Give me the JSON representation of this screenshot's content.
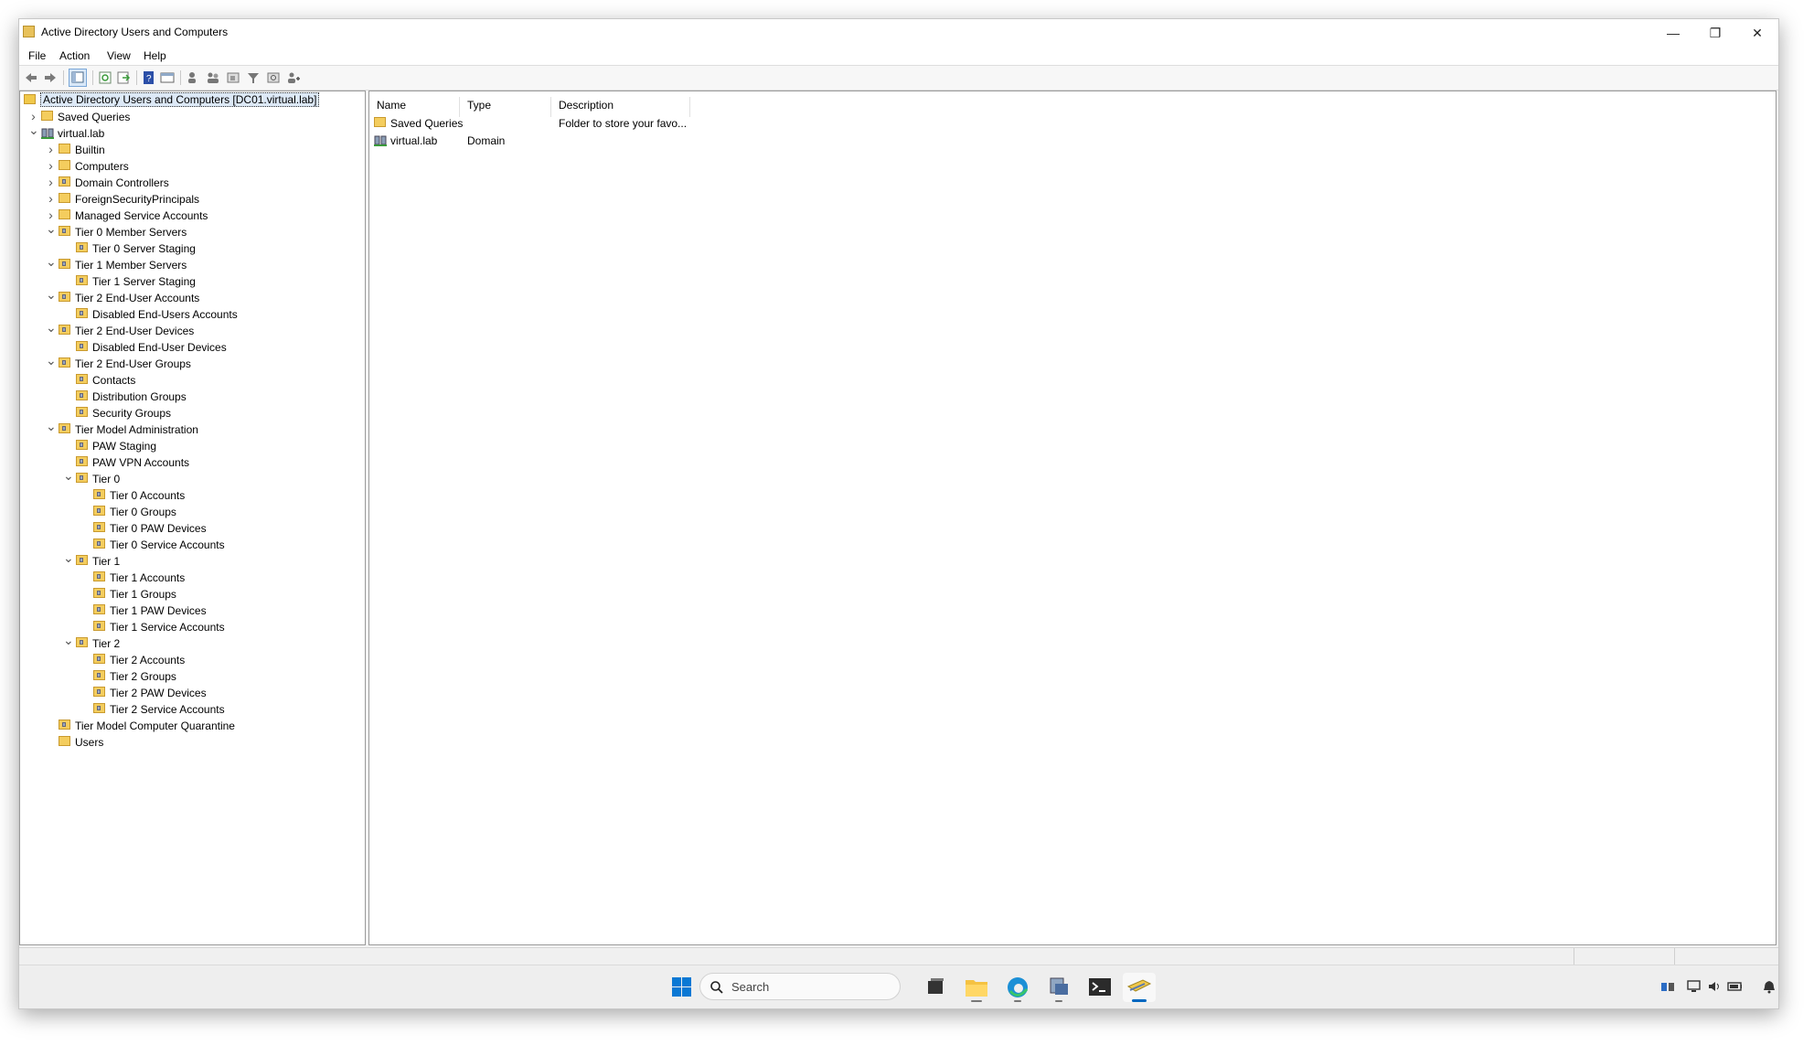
{
  "window": {
    "title": "Active Directory Users and Computers"
  },
  "controls": {
    "minimize": "—",
    "restore": "❐",
    "close": "✕"
  },
  "menu": [
    "File",
    "Action",
    "View",
    "Help"
  ],
  "toolbar_icons": [
    "back-icon",
    "forward-icon",
    "show-hide-tree-icon",
    "refresh-icon",
    "export-list-icon",
    "help-icon",
    "properties-icon",
    "new-user-icon",
    "new-group-icon",
    "new-ou-icon",
    "filter-icon",
    "find-icon",
    "add-to-group-icon"
  ],
  "tree": [
    {
      "label": "Active Directory Users and Computers [DC01.virtual.lab]",
      "level": 0,
      "icon": "root",
      "expander": "",
      "selected": true
    },
    {
      "label": "Saved Queries",
      "level": 1,
      "icon": "folder",
      "expander": "collapsed"
    },
    {
      "label": "virtual.lab",
      "level": 1,
      "icon": "domain",
      "expander": "expanded"
    },
    {
      "label": "Builtin",
      "level": 2,
      "icon": "folder",
      "expander": "collapsed"
    },
    {
      "label": "Computers",
      "level": 2,
      "icon": "folder",
      "expander": "collapsed"
    },
    {
      "label": "Domain Controllers",
      "level": 2,
      "icon": "ou",
      "expander": "collapsed"
    },
    {
      "label": "ForeignSecurityPrincipals",
      "level": 2,
      "icon": "folder",
      "expander": "collapsed"
    },
    {
      "label": "Managed Service Accounts",
      "level": 2,
      "icon": "folder",
      "expander": "collapsed"
    },
    {
      "label": "Tier 0 Member Servers",
      "level": 2,
      "icon": "ou",
      "expander": "expanded"
    },
    {
      "label": "Tier 0 Server Staging",
      "level": 3,
      "icon": "ou",
      "expander": ""
    },
    {
      "label": "Tier 1 Member Servers",
      "level": 2,
      "icon": "ou",
      "expander": "expanded"
    },
    {
      "label": "Tier 1 Server Staging",
      "level": 3,
      "icon": "ou",
      "expander": ""
    },
    {
      "label": "Tier 2 End-User Accounts",
      "level": 2,
      "icon": "ou",
      "expander": "expanded"
    },
    {
      "label": "Disabled End-Users Accounts",
      "level": 3,
      "icon": "ou",
      "expander": ""
    },
    {
      "label": "Tier 2 End-User Devices",
      "level": 2,
      "icon": "ou",
      "expander": "expanded"
    },
    {
      "label": "Disabled End-User Devices",
      "level": 3,
      "icon": "ou",
      "expander": ""
    },
    {
      "label": "Tier 2 End-User Groups",
      "level": 2,
      "icon": "ou",
      "expander": "expanded"
    },
    {
      "label": "Contacts",
      "level": 3,
      "icon": "ou",
      "expander": ""
    },
    {
      "label": "Distribution Groups",
      "level": 3,
      "icon": "ou",
      "expander": ""
    },
    {
      "label": "Security Groups",
      "level": 3,
      "icon": "ou",
      "expander": ""
    },
    {
      "label": "Tier Model Administration",
      "level": 2,
      "icon": "ou",
      "expander": "expanded"
    },
    {
      "label": "PAW Staging",
      "level": 3,
      "icon": "ou",
      "expander": ""
    },
    {
      "label": "PAW VPN Accounts",
      "level": 3,
      "icon": "ou",
      "expander": ""
    },
    {
      "label": "Tier 0",
      "level": 3,
      "icon": "ou",
      "expander": "expanded"
    },
    {
      "label": "Tier 0 Accounts",
      "level": 4,
      "icon": "ou",
      "expander": ""
    },
    {
      "label": "Tier 0 Groups",
      "level": 4,
      "icon": "ou",
      "expander": ""
    },
    {
      "label": "Tier 0 PAW Devices",
      "level": 4,
      "icon": "ou",
      "expander": ""
    },
    {
      "label": "Tier 0 Service Accounts",
      "level": 4,
      "icon": "ou",
      "expander": ""
    },
    {
      "label": "Tier 1",
      "level": 3,
      "icon": "ou",
      "expander": "expanded"
    },
    {
      "label": "Tier 1 Accounts",
      "level": 4,
      "icon": "ou",
      "expander": ""
    },
    {
      "label": "Tier 1 Groups",
      "level": 4,
      "icon": "ou",
      "expander": ""
    },
    {
      "label": "Tier 1 PAW Devices",
      "level": 4,
      "icon": "ou",
      "expander": ""
    },
    {
      "label": "Tier 1 Service Accounts",
      "level": 4,
      "icon": "ou",
      "expander": ""
    },
    {
      "label": "Tier 2",
      "level": 3,
      "icon": "ou",
      "expander": "expanded"
    },
    {
      "label": "Tier 2 Accounts",
      "level": 4,
      "icon": "ou",
      "expander": ""
    },
    {
      "label": "Tier 2 Groups",
      "level": 4,
      "icon": "ou",
      "expander": ""
    },
    {
      "label": "Tier 2 PAW Devices",
      "level": 4,
      "icon": "ou",
      "expander": ""
    },
    {
      "label": "Tier 2 Service Accounts",
      "level": 4,
      "icon": "ou",
      "expander": ""
    },
    {
      "label": "Tier Model Computer Quarantine",
      "level": 2,
      "icon": "ou",
      "expander": ""
    },
    {
      "label": "Users",
      "level": 2,
      "icon": "folder",
      "expander": ""
    }
  ],
  "list": {
    "columns": [
      "Name",
      "Type",
      "Description"
    ],
    "rows": [
      {
        "icon": "folder",
        "name": "Saved Queries",
        "type": "",
        "description": "Folder to store your favo..."
      },
      {
        "icon": "domain",
        "name": "virtual.lab",
        "type": "Domain",
        "description": ""
      }
    ]
  },
  "taskbar": {
    "search_placeholder": "Search",
    "apps": [
      "start-icon",
      "task-view-icon",
      "file-explorer-icon",
      "edge-icon",
      "server-manager-icon",
      "terminal-icon",
      "aduc-icon"
    ],
    "tray": [
      "network-status-icon",
      "display-icon",
      "volume-icon",
      "battery-icon",
      "notification-icon"
    ]
  },
  "colors": {
    "folder": "#f4cd5e",
    "selection": "#dde9f7",
    "accent": "#0067c0"
  }
}
